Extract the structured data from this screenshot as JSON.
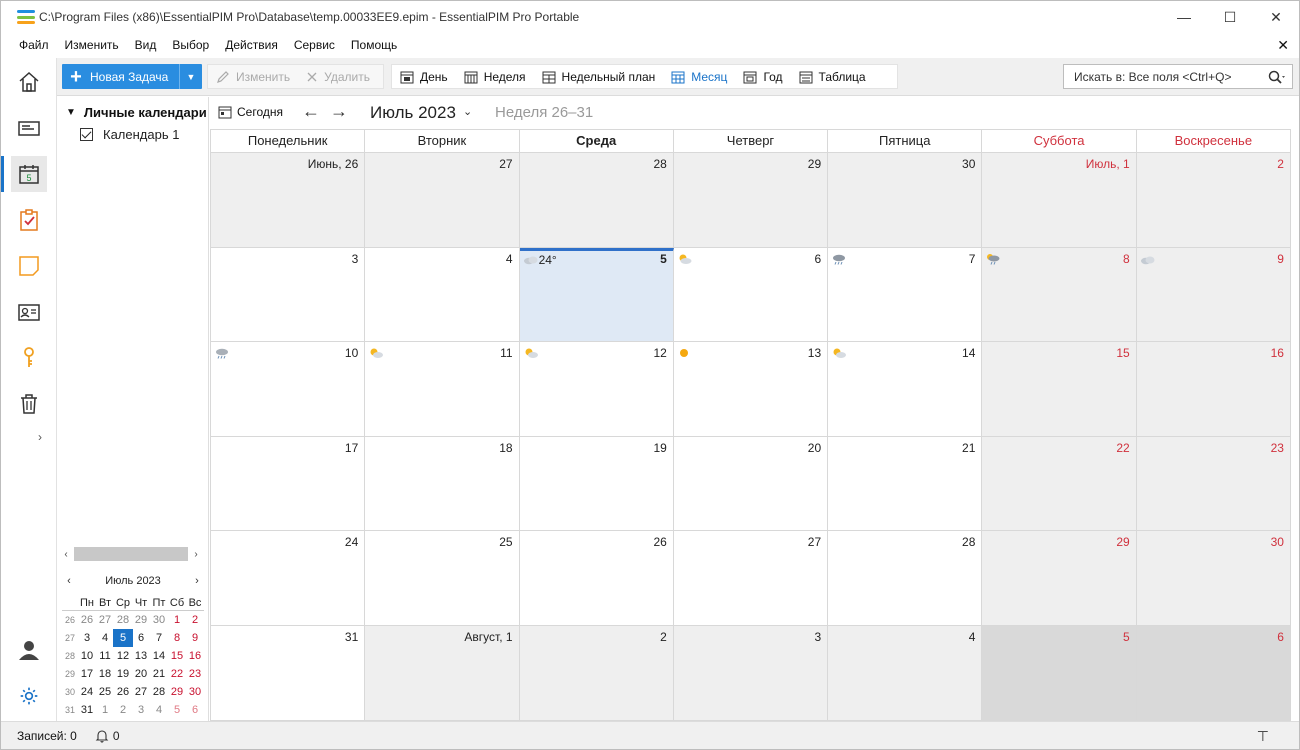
{
  "window": {
    "title": "C:\\Program Files (x86)\\EssentialPIM Pro\\Database\\temp.00033EE9.epim - EssentialPIM Pro Portable",
    "minimize": "—",
    "maximize": "☐",
    "close": "✕"
  },
  "menu": {
    "items": [
      "Файл",
      "Изменить",
      "Вид",
      "Выбор",
      "Действия",
      "Сервис",
      "Помощь"
    ],
    "close": "✕"
  },
  "toolbar": {
    "new_task": "Новая Задача",
    "edit": "Изменить",
    "delete": "Удалить",
    "views": {
      "day": "День",
      "week": "Неделя",
      "week_plan": "Недельный план",
      "month": "Месяц",
      "year": "Год",
      "table": "Таблица"
    },
    "active_view": "Месяц",
    "search_placeholder": "Искать в: Все поля  <Ctrl+Q>"
  },
  "left_panel": {
    "group": "Личные календари",
    "calendar": "Календарь 1",
    "mini_calendar": {
      "title": "Июль  2023",
      "weekdays": [
        "Пн",
        "Вт",
        "Ср",
        "Чт",
        "Пт",
        "Сб",
        "Вс"
      ],
      "weeks": [
        {
          "wk": "26",
          "days": [
            "26",
            "27",
            "28",
            "29",
            "30",
            "1",
            "2"
          ]
        },
        {
          "wk": "27",
          "days": [
            "3",
            "4",
            "5",
            "6",
            "7",
            "8",
            "9"
          ]
        },
        {
          "wk": "28",
          "days": [
            "10",
            "11",
            "12",
            "13",
            "14",
            "15",
            "16"
          ]
        },
        {
          "wk": "29",
          "days": [
            "17",
            "18",
            "19",
            "20",
            "21",
            "22",
            "23"
          ]
        },
        {
          "wk": "30",
          "days": [
            "24",
            "25",
            "26",
            "27",
            "28",
            "29",
            "30"
          ]
        },
        {
          "wk": "31",
          "days": [
            "31",
            "1",
            "2",
            "3",
            "4",
            "5",
            "6"
          ]
        }
      ],
      "today": "5"
    }
  },
  "calendar_nav": {
    "today": "Сегодня",
    "prev": "←",
    "next": "→",
    "month_title": "Июль 2023",
    "week_range": "Неделя 26–31"
  },
  "calendar": {
    "day_headers": [
      "Понедельник",
      "Вторник",
      "Среда",
      "Четверг",
      "Пятница",
      "Суббота",
      "Воскресенье"
    ],
    "weeks": [
      [
        "Июнь, 26",
        "27",
        "28",
        "29",
        "30",
        "Июль, 1",
        "2"
      ],
      [
        "3",
        "4",
        "5",
        "6",
        "7",
        "8",
        "9"
      ],
      [
        "10",
        "11",
        "12",
        "13",
        "14",
        "15",
        "16"
      ],
      [
        "17",
        "18",
        "19",
        "20",
        "21",
        "22",
        "23"
      ],
      [
        "24",
        "25",
        "26",
        "27",
        "28",
        "29",
        "30"
      ],
      [
        "31",
        "Август, 1",
        "2",
        "3",
        "4",
        "5",
        "6"
      ]
    ],
    "today_temperature": "24°",
    "weather": {
      "w1": [
        "",
        "",
        "cloudy",
        "partly-sunny",
        "rain",
        "rain-sun",
        "cloudy"
      ],
      "w2": [
        "rain",
        "partly-sunny",
        "partly-sunny",
        "sunny",
        "partly-sunny",
        "",
        ""
      ]
    }
  },
  "status": {
    "records": "Записей: 0",
    "reminders": "0"
  },
  "colors": {
    "accent": "#2a8de0",
    "weekend_red": "#d0313d",
    "today_bg": "#dfe9f5"
  }
}
